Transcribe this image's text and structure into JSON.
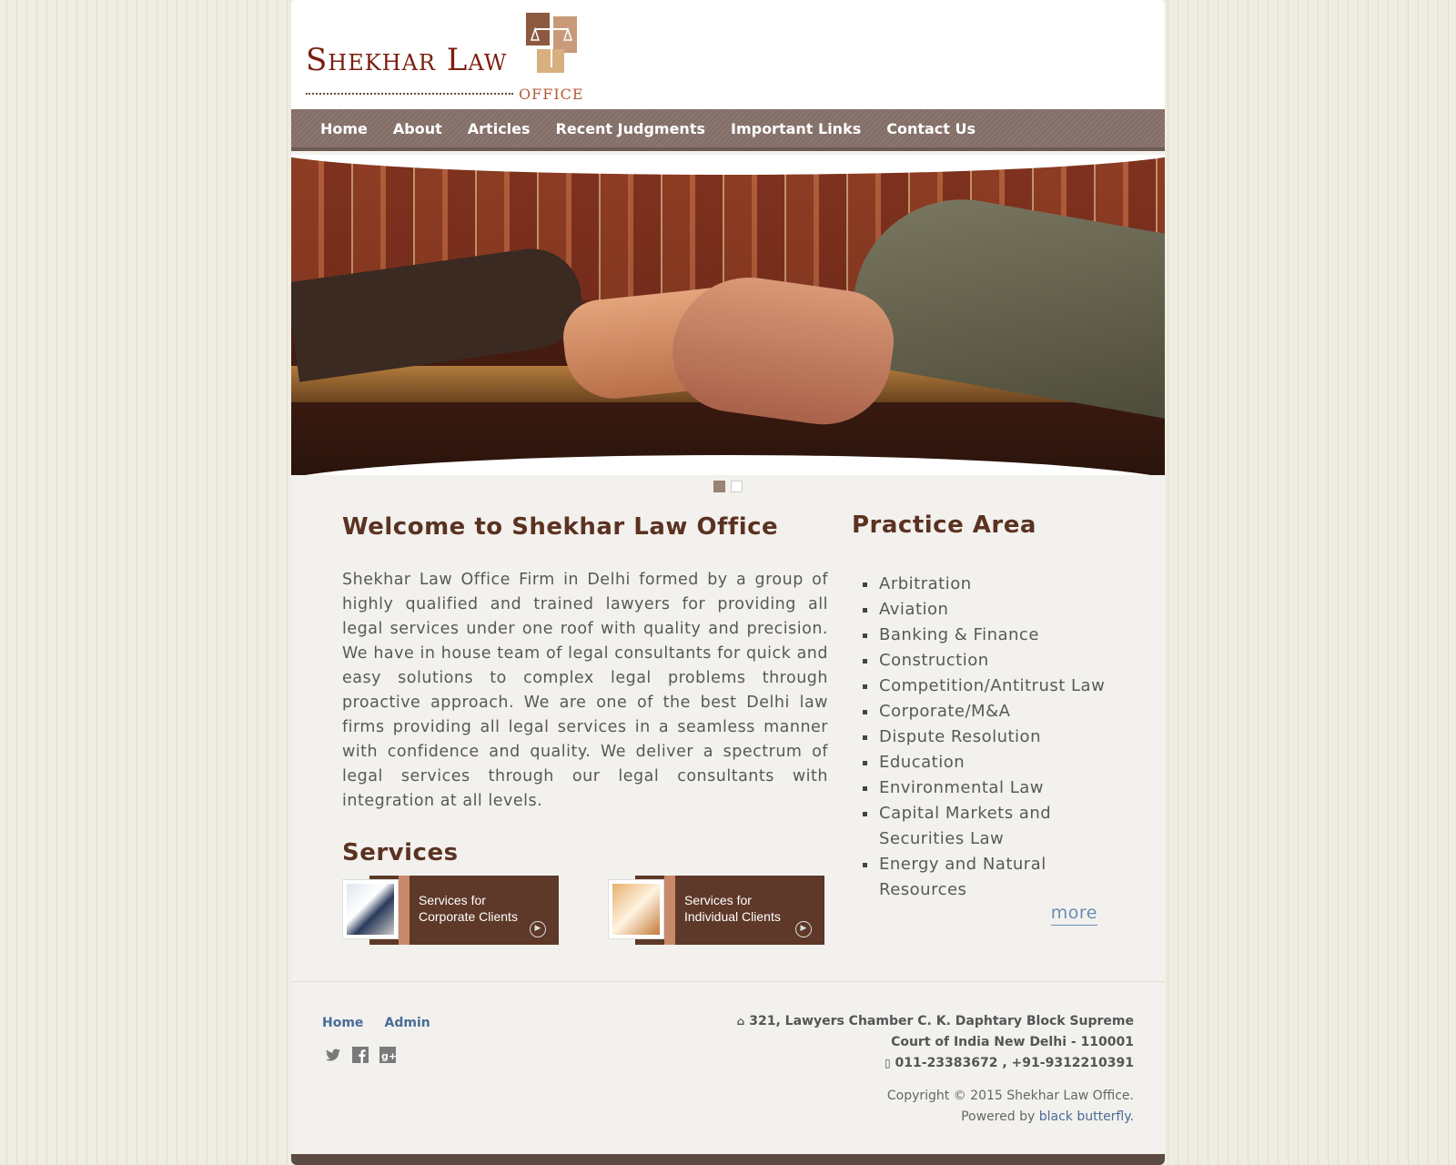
{
  "logo": {
    "title": "Shekhar Law",
    "subtitle": "OFFICE"
  },
  "nav": {
    "items": [
      "Home",
      "About",
      "Articles",
      "Recent Judgments",
      "Important Links",
      "Contact Us"
    ]
  },
  "slider": {
    "slides_total": 2,
    "active_slide": 1
  },
  "welcome": {
    "title": "Welcome to Shekhar Law Office",
    "text": "Shekhar Law Office Firm in Delhi formed by a group of highly qualified and trained lawyers for providing all legal services under one roof with quality and precision. We have in house team of legal consultants for quick and easy solutions to complex legal problems through proactive approach. We are one of the best Delhi law firms providing all legal services in a seamless manner with confidence and quality. We deliver a spectrum of legal services through our legal consultants with integration at all levels."
  },
  "services": {
    "title": "Services",
    "items": [
      {
        "line1": "Services for",
        "line2": "Corporate Clients"
      },
      {
        "line1": "Services for",
        "line2": "Individual Clients"
      }
    ]
  },
  "practice": {
    "title": "Practice Area",
    "items": [
      "Arbitration",
      "Aviation",
      "Banking & Finance",
      "Construction",
      "Competition/Antitrust Law",
      "Corporate/M&A",
      "Dispute Resolution",
      "Education",
      "Environmental Law",
      "Capital Markets and Securities Law",
      "Energy and Natural Resources"
    ],
    "more_label": "more"
  },
  "footer": {
    "links": [
      "Home",
      "Admin"
    ],
    "social": [
      "twitter-icon",
      "facebook-icon",
      "google-plus-icon"
    ],
    "address_line1": "321, Lawyers Chamber C. K. Daphtary Block Supreme",
    "address_line2": "Court of India New Delhi - 110001",
    "phone": "011-23383672 , +91-9312210391",
    "copyright": "Copyright © 2015 Shekhar Law Office.",
    "powered_prefix": "Powered by",
    "powered_link": "black butterfly",
    "powered_suffix": "."
  },
  "colors": {
    "nav_bg": "#86716a",
    "heading": "#5b3221",
    "service_bg": "#5e3828",
    "link": "#4a6c97"
  }
}
